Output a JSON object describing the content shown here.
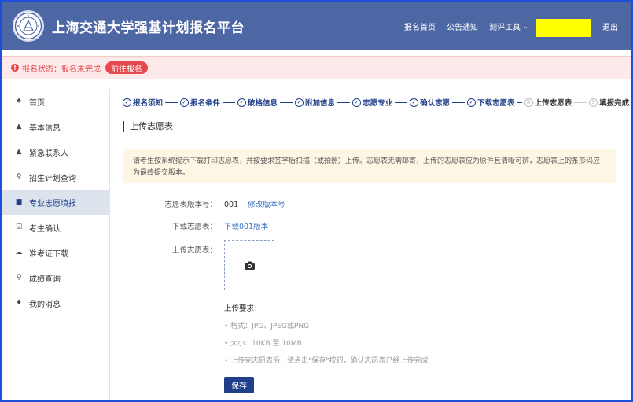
{
  "header": {
    "title": "上海交通大学强基计划报名平台",
    "nav": {
      "home": "报名首页",
      "notice": "公告通知",
      "tools": "测评工具",
      "logout": "退出"
    },
    "highlight_color": "#ffff00"
  },
  "status": {
    "icon": "!",
    "text": "报名状态：报名未完成",
    "button": "前往报名"
  },
  "sidebar": {
    "items": [
      {
        "icon": "home-icon",
        "glyph": "♠",
        "label": "首页"
      },
      {
        "icon": "user-icon",
        "glyph": "▲",
        "label": "基本信息"
      },
      {
        "icon": "contact-icon",
        "glyph": "▲",
        "label": "紧急联系人"
      },
      {
        "icon": "search-icon",
        "glyph": "⚲",
        "label": "招生计划查询"
      },
      {
        "icon": "form-icon",
        "glyph": "■",
        "label": "专业志愿填报"
      },
      {
        "icon": "confirm-icon",
        "glyph": "☑",
        "label": "考生确认"
      },
      {
        "icon": "cloud-download-icon",
        "glyph": "☁",
        "label": "准考证下载"
      },
      {
        "icon": "search-icon",
        "glyph": "⚲",
        "label": "成绩查询"
      },
      {
        "icon": "bell-icon",
        "glyph": "♦",
        "label": "我的消息"
      }
    ],
    "active_index": 4
  },
  "steps": {
    "items": [
      {
        "num": "✓",
        "label": "报名须知",
        "done": true
      },
      {
        "num": "✓",
        "label": "报名条件",
        "done": true
      },
      {
        "num": "✓",
        "label": "破格信息",
        "done": true
      },
      {
        "num": "✓",
        "label": "附加信息",
        "done": true
      },
      {
        "num": "✓",
        "label": "志愿专业",
        "done": true
      },
      {
        "num": "✓",
        "label": "确认志愿",
        "done": true
      },
      {
        "num": "✓",
        "label": "下载志愿表",
        "done": true
      },
      {
        "num": "8",
        "label": "上传志愿表",
        "done": false
      },
      {
        "num": "9",
        "label": "填报完成",
        "done": false
      }
    ]
  },
  "main": {
    "section_title": "上传志愿表",
    "notice": "请考生按系统提示下载打印志愿表，并按要求签字后扫描（或拍照）上传。志愿表无需邮寄，上传的志愿表应为原件且清晰可辨，志愿表上的条形码应为最终提交版本。",
    "version_label": "志愿表版本号：",
    "version_value": "001",
    "version_link": "修改版本号",
    "download_label": "下载志愿表：",
    "download_link": "下载001版本",
    "upload_label": "上传志愿表：",
    "requirements_title": "上传要求：",
    "requirements": [
      "• 格式：JPG、JPEG或PNG",
      "• 大小：10KB 至 10MB",
      "• 上传完志愿表后，请点击\"保存\"按钮，确认志愿表已经上传完成"
    ],
    "save_button": "保存"
  },
  "colors": {
    "header_bg": "#4d67a4",
    "primary": "#1f3f8a",
    "link": "#3b73c6",
    "status_red": "#e5484d",
    "notice_bg": "#fdf6e4"
  }
}
